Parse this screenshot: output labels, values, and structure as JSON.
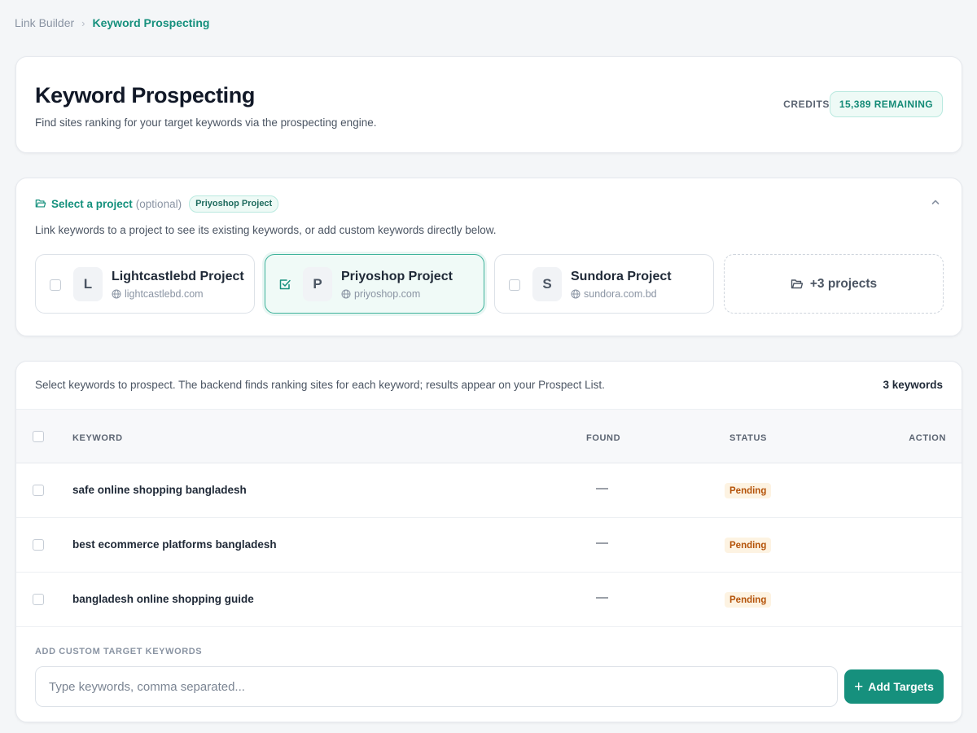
{
  "breadcrumb": {
    "parent": "Link Builder",
    "separator": "›",
    "current": "Keyword Prospecting"
  },
  "header": {
    "title": "Keyword Prospecting",
    "subtitle": "Find sites ranking for your target keywords via the prospecting engine.",
    "credits_label": "CREDITS",
    "credits_value": "15,389 REMAINING"
  },
  "project_section": {
    "title": "Select a project",
    "optional": "(optional)",
    "selected_badge": "Priyoshop Project",
    "description": "Link keywords to a project to see its existing keywords, or add custom keywords directly below.",
    "projects": [
      {
        "initial": "L",
        "name": "Lightcastlebd Project",
        "domain": "lightcastlebd.com",
        "selected": false
      },
      {
        "initial": "P",
        "name": "Priyoshop Project",
        "domain": "priyoshop.com",
        "selected": true
      },
      {
        "initial": "S",
        "name": "Sundora Project",
        "domain": "sundora.com.bd",
        "selected": false
      }
    ],
    "more_label": "+3 projects"
  },
  "keywords_section": {
    "intro": "Select keywords to prospect. The backend finds ranking sites for each keyword; results appear on your Prospect List.",
    "count_label": "3 keywords",
    "columns": {
      "keyword": "KEYWORD",
      "found": "FOUND",
      "status": "STATUS",
      "action": "ACTION"
    },
    "rows": [
      {
        "keyword": "safe online shopping bangladesh",
        "found": "—",
        "status": "Pending"
      },
      {
        "keyword": "best ecommerce platforms bangladesh",
        "found": "—",
        "status": "Pending"
      },
      {
        "keyword": "bangladesh online shopping guide",
        "found": "—",
        "status": "Pending"
      }
    ],
    "custom_label": "ADD CUSTOM TARGET KEYWORDS",
    "input_placeholder": "Type keywords, comma separated...",
    "input_value": "",
    "add_button_label": "Add Targets"
  },
  "colors": {
    "accent": "#16907d",
    "pending_text": "#b45309",
    "pending_bg": "#fdf3e2",
    "page_bg": "#f4f6f8"
  },
  "icons": {
    "breadcrumb_separator": "chevron-right-icon",
    "project_folder": "folder-open-icon",
    "collapse": "chevron-up-icon",
    "domain": "globe-icon",
    "selected_checkbox": "check-square-icon",
    "add": "plus-icon"
  }
}
